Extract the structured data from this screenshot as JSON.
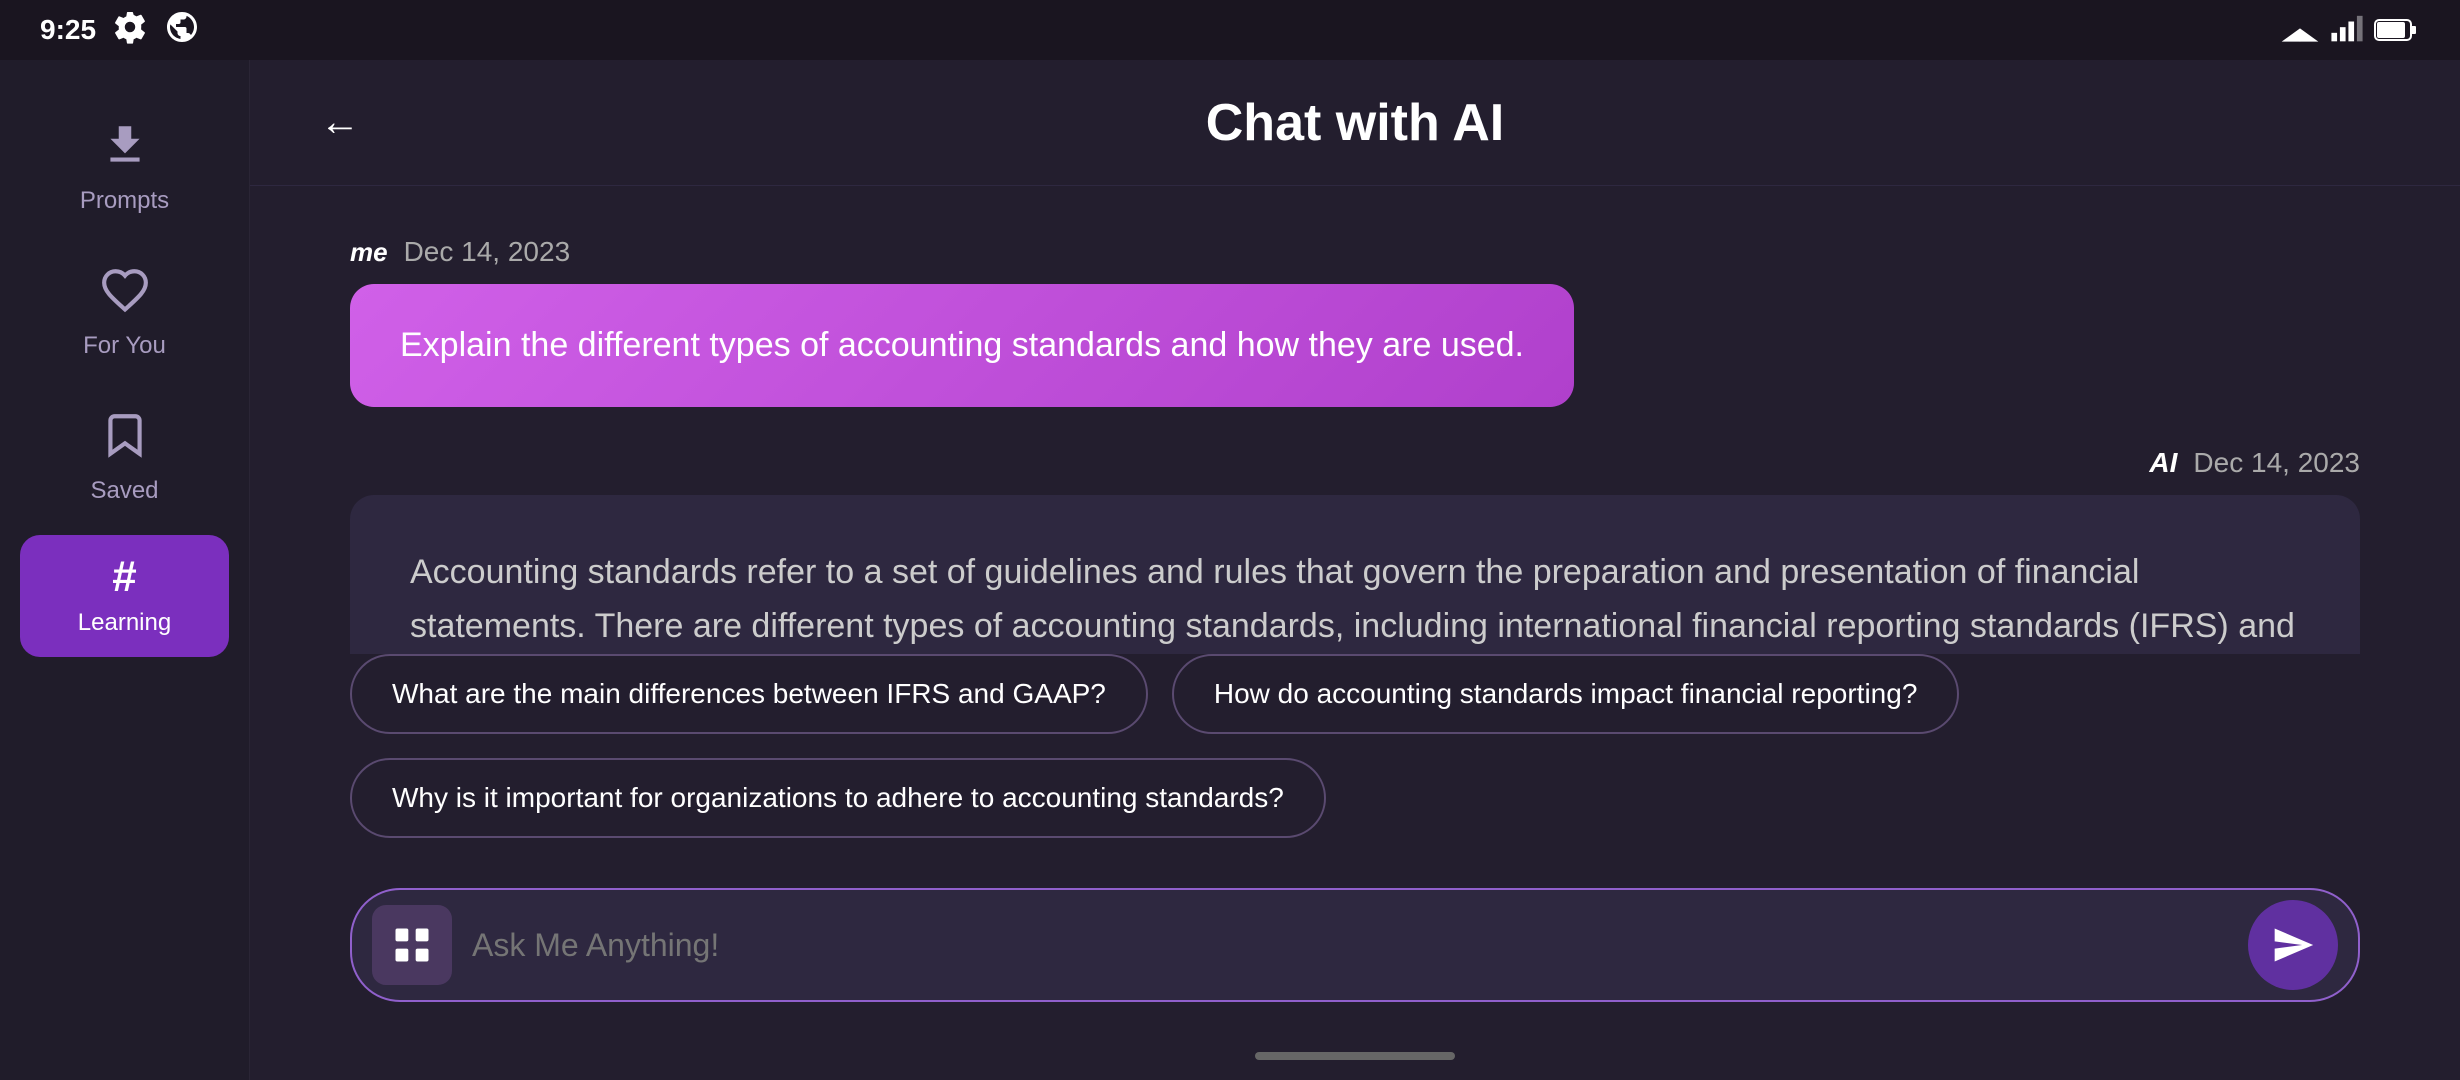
{
  "statusBar": {
    "time": "9:25",
    "icons": [
      "settings",
      "world"
    ]
  },
  "sidebar": {
    "items": [
      {
        "id": "prompts",
        "label": "Prompts",
        "icon": "⬇"
      },
      {
        "id": "for-you",
        "label": "For You",
        "icon": "♡"
      },
      {
        "id": "saved",
        "label": "Saved",
        "icon": "🔖"
      },
      {
        "id": "learning",
        "label": "Learning",
        "icon": "#",
        "active": true
      }
    ]
  },
  "header": {
    "back_label": "←",
    "title": "Chat with AI"
  },
  "chat": {
    "userMessage": {
      "senderBadge": "me",
      "date": "Dec 14, 2023",
      "text": "Explain the different types of accounting standards and how they are used."
    },
    "aiMessage": {
      "senderBadge": "AI",
      "date": "Dec 14, 2023",
      "text": "Accounting standards refer to a set of guidelines and rules that govern the preparation and presentation of financial statements. There are different types of accounting standards, including international financial reporting standards (IFRS) and generally accepted accounting principles (GAAP). These standards are used to ensure consistency, transparency, and comparability in financial reporting across different organizations and countries."
    },
    "suggestions": [
      "What are the main differences between IFRS and GAAP?",
      "How do accounting standards impact financial reporting?",
      "Why is it important for organizations to adhere to accounting standards?"
    ],
    "inputPlaceholder": "Ask Me Anything!"
  }
}
